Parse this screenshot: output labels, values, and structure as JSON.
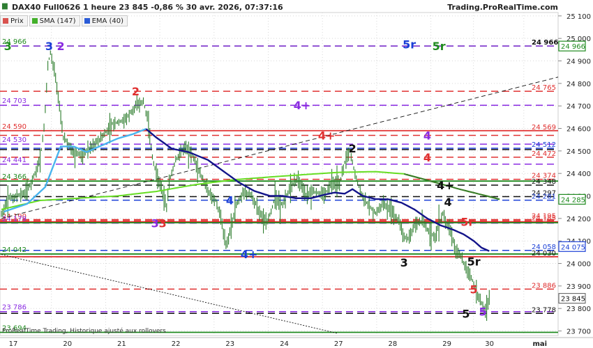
{
  "header": {
    "title": "DAX40 Full0626 1 heure 23 845 -0,86 % 30 avr. 2026, 07:37:16",
    "site": "Trading.ProRealTime.com"
  },
  "legend": [
    {
      "label": "Prix",
      "color": "#d9534f"
    },
    {
      "label": "SMA (147)",
      "color": "#43b02a"
    },
    {
      "label": "EMA (40)",
      "color": "#2a5bd7"
    }
  ],
  "footer": "ProRealTime Trading, Historique ajusté aux rollovers",
  "colors": {
    "green": "#1e8a1e",
    "purple": "#8a2be2",
    "red": "#e03030",
    "blue": "#1a3fd6",
    "black": "#111111",
    "sma": "#66dd22",
    "ema": "#49b4ee",
    "navy": "#13148a",
    "dark_green": "#3a7a2a"
  },
  "chart_data": {
    "type": "line",
    "x_ticks": [
      "17",
      "20",
      "21",
      "22",
      "23",
      "24",
      "27",
      "28",
      "29",
      "30",
      "mai"
    ],
    "y_ticks": [
      23700,
      23800,
      23900,
      24000,
      24100,
      24200,
      24300,
      24400,
      24500,
      24600,
      24700,
      24800,
      24900,
      25000,
      25100
    ],
    "y_tick_labels": [
      "23 700",
      "23 800",
      "23 900",
      "24 000",
      "24 100",
      "24 200",
      "24 300",
      "24 400",
      "24 500",
      "24 600",
      "24 700",
      "24 800",
      "24 900",
      "25 000",
      "25 100"
    ],
    "ylim": [
      23680,
      25115
    ],
    "last_price": {
      "value": 23845,
      "label": "23 845"
    },
    "price_boxes": [
      {
        "value": 24966,
        "label": "24 966",
        "color": "green"
      },
      {
        "value": 24285,
        "label": "24 285",
        "color": "green"
      },
      {
        "value": 24075,
        "label": "24 075",
        "color": "blue"
      }
    ],
    "levels": [
      {
        "value": 24966,
        "color": "green",
        "style": "dashed",
        "left": "24 966",
        "right": "24 966"
      },
      {
        "value": 24966,
        "color": "purple",
        "style": "dashed",
        "left": "",
        "right": ""
      },
      {
        "value": 24765,
        "color": "red",
        "style": "dashed",
        "left": "",
        "right": "24 765"
      },
      {
        "value": 24703,
        "color": "purple",
        "style": "dashed",
        "left": "24 703",
        "right": ""
      },
      {
        "value": 24590,
        "color": "red",
        "style": "solid",
        "left": "24 590",
        "right": "24 569"
      },
      {
        "value": 24569,
        "color": "red",
        "style": "dashed",
        "left": "",
        "right": ""
      },
      {
        "value": 24530,
        "color": "purple",
        "style": "dashed",
        "left": "24 530",
        "right": ""
      },
      {
        "value": 24512,
        "color": "blue",
        "style": "dashed",
        "left": "",
        "right": "24 512"
      },
      {
        "value": 24506,
        "color": "black",
        "style": "dashed",
        "left": "",
        "right": ""
      },
      {
        "value": 24472,
        "color": "red",
        "style": "dashed",
        "left": "",
        "right": "24 472"
      },
      {
        "value": 24441,
        "color": "purple",
        "style": "dashed",
        "left": "24 441",
        "right": ""
      },
      {
        "value": 24374,
        "color": "red",
        "style": "dashed",
        "left": "",
        "right": "24 374"
      },
      {
        "value": 24366,
        "color": "green",
        "style": "solid",
        "left": "24 366",
        "right": ""
      },
      {
        "value": 24348,
        "color": "black",
        "style": "dashed",
        "left": "",
        "right": "24 348"
      },
      {
        "value": 24297,
        "color": "black",
        "style": "dashed",
        "left": "",
        "right": "24 297"
      },
      {
        "value": 24281,
        "color": "blue",
        "style": "dashed",
        "left": "",
        "right": "24 281"
      },
      {
        "value": 24195,
        "color": "red",
        "style": "dashed",
        "left": "",
        "right": "24 195"
      },
      {
        "value": 24190,
        "color": "red",
        "style": "dashed",
        "left": "24 190",
        "right": ""
      },
      {
        "value": 24185,
        "color": "red",
        "style": "solid",
        "left": "",
        "right": "24 185"
      },
      {
        "value": 24179,
        "color": "purple",
        "style": "dashed",
        "left": "24 179",
        "right": ""
      },
      {
        "value": 24181,
        "color": "green",
        "style": "solid",
        "left": "",
        "right": ""
      },
      {
        "value": 24058,
        "color": "blue",
        "style": "dashed",
        "left": "",
        "right": "24 058"
      },
      {
        "value": 24042,
        "color": "green",
        "style": "solid",
        "left": "24 042",
        "right": ""
      },
      {
        "value": 24030,
        "color": "black",
        "style": "dashed",
        "left": "",
        "right": "24 030"
      },
      {
        "value": 24030,
        "color": "red",
        "style": "solid",
        "left": "",
        "right": ""
      },
      {
        "value": 23886,
        "color": "red",
        "style": "dashed",
        "left": "",
        "right": "23 886"
      },
      {
        "value": 23786,
        "color": "purple",
        "style": "dashed",
        "left": "23 786",
        "right": ""
      },
      {
        "value": 23778,
        "color": "black",
        "style": "dashed",
        "left": "",
        "right": "23 778"
      },
      {
        "value": 23694,
        "color": "green",
        "style": "solid",
        "left": "23 694",
        "right": ""
      }
    ],
    "markers": [
      {
        "text": "3",
        "color": "green",
        "bar": 5,
        "value": 24966,
        "size": 16
      },
      {
        "text": "3",
        "color": "blue",
        "bar": 37,
        "value": 24966,
        "size": 16
      },
      {
        "text": "2",
        "color": "purple",
        "bar": 46,
        "value": 24966,
        "size": 16
      },
      {
        "text": "5r",
        "color": "blue",
        "bar": 316,
        "value": 24975,
        "size": 16
      },
      {
        "text": "5r",
        "color": "green",
        "bar": 339,
        "value": 24966,
        "size": 16
      },
      {
        "text": "2",
        "color": "red",
        "bar": 104,
        "value": 24765,
        "size": 16
      },
      {
        "text": "4+",
        "color": "purple",
        "bar": 233,
        "value": 24703,
        "size": 16
      },
      {
        "text": "4+",
        "color": "red",
        "bar": 252,
        "value": 24569,
        "size": 16
      },
      {
        "text": "4",
        "color": "purple",
        "bar": 330,
        "value": 24569,
        "size": 16
      },
      {
        "text": "2",
        "color": "black",
        "bar": 272,
        "value": 24512,
        "size": 16
      },
      {
        "text": "4",
        "color": "red",
        "bar": 330,
        "value": 24472,
        "size": 16
      },
      {
        "text": "4+",
        "color": "black",
        "bar": 344,
        "value": 24348,
        "size": 16
      },
      {
        "text": "4",
        "color": "blue",
        "bar": 177,
        "value": 24281,
        "size": 16
      },
      {
        "text": "4",
        "color": "black",
        "bar": 346,
        "value": 24274,
        "size": 16
      },
      {
        "text": "3",
        "color": "purple",
        "bar": 119,
        "value": 24179,
        "size": 16
      },
      {
        "text": "3",
        "color": "red",
        "bar": 125,
        "value": 24179,
        "size": 16
      },
      {
        "text": "5r",
        "color": "red",
        "bar": 361,
        "value": 24185,
        "size": 16
      },
      {
        "text": "4+",
        "color": "blue",
        "bar": 192,
        "value": 24042,
        "size": 16
      },
      {
        "text": "3",
        "color": "black",
        "bar": 312,
        "value": 24004,
        "size": 16
      },
      {
        "text": "5r",
        "color": "black",
        "bar": 366,
        "value": 24010,
        "size": 16
      },
      {
        "text": "5",
        "color": "red",
        "bar": 366,
        "value": 23886,
        "size": 16
      },
      {
        "text": "5",
        "color": "black",
        "bar": 360,
        "value": 23778,
        "size": 16
      },
      {
        "text": "5",
        "color": "purple",
        "bar": 373,
        "value": 23786,
        "size": 16
      }
    ],
    "days": [
      {
        "label": "17",
        "start": 0
      },
      {
        "label": "20",
        "start": 42
      },
      {
        "label": "21",
        "start": 84
      },
      {
        "label": "22",
        "start": 126
      },
      {
        "label": "23",
        "start": 168
      },
      {
        "label": "24",
        "start": 210
      },
      {
        "label": "27",
        "start": 252
      },
      {
        "label": "28",
        "start": 294
      },
      {
        "label": "29",
        "start": 336
      },
      {
        "label": "30",
        "start": 369
      },
      {
        "label": "mai",
        "start": 408
      }
    ],
    "price_anchors": [
      [
        0,
        24222
      ],
      [
        6,
        24290
      ],
      [
        12,
        24300
      ],
      [
        18,
        24310
      ],
      [
        24,
        24370
      ],
      [
        30,
        24460
      ],
      [
        33,
        24600
      ],
      [
        36,
        24880
      ],
      [
        38,
        24940
      ],
      [
        41,
        24860
      ],
      [
        44,
        24740
      ],
      [
        48,
        24560
      ],
      [
        52,
        24530
      ],
      [
        56,
        24490
      ],
      [
        62,
        24480
      ],
      [
        70,
        24520
      ],
      [
        78,
        24560
      ],
      [
        86,
        24620
      ],
      [
        96,
        24640
      ],
      [
        104,
        24700
      ],
      [
        110,
        24720
      ],
      [
        114,
        24620
      ],
      [
        117,
        24470
      ],
      [
        120,
        24400
      ],
      [
        124,
        24330
      ],
      [
        128,
        24250
      ],
      [
        130,
        24360
      ],
      [
        135,
        24460
      ],
      [
        142,
        24520
      ],
      [
        148,
        24480
      ],
      [
        154,
        24400
      ],
      [
        160,
        24320
      ],
      [
        166,
        24280
      ],
      [
        170,
        24200
      ],
      [
        174,
        24080
      ],
      [
        178,
        24160
      ],
      [
        182,
        24260
      ],
      [
        188,
        24320
      ],
      [
        194,
        24300
      ],
      [
        200,
        24230
      ],
      [
        206,
        24180
      ],
      [
        212,
        24290
      ],
      [
        218,
        24260
      ],
      [
        224,
        24340
      ],
      [
        230,
        24380
      ],
      [
        236,
        24300
      ],
      [
        242,
        24320
      ],
      [
        250,
        24300
      ],
      [
        256,
        24360
      ],
      [
        262,
        24350
      ],
      [
        266,
        24450
      ],
      [
        270,
        24500
      ],
      [
        274,
        24400
      ],
      [
        278,
        24320
      ],
      [
        284,
        24260
      ],
      [
        290,
        24220
      ],
      [
        296,
        24270
      ],
      [
        302,
        24230
      ],
      [
        308,
        24190
      ],
      [
        312,
        24120
      ],
      [
        316,
        24110
      ],
      [
        320,
        24170
      ],
      [
        326,
        24190
      ],
      [
        330,
        24150
      ],
      [
        336,
        24120
      ],
      [
        342,
        24220
      ],
      [
        348,
        24140
      ],
      [
        352,
        24060
      ],
      [
        356,
        24030
      ],
      [
        360,
        23980
      ],
      [
        364,
        23940
      ],
      [
        368,
        23870
      ],
      [
        372,
        23820
      ],
      [
        375,
        23790
      ],
      [
        378,
        23845
      ]
    ],
    "sma_anchors": [
      [
        0,
        24240
      ],
      [
        30,
        24280
      ],
      [
        60,
        24290
      ],
      [
        90,
        24300
      ],
      [
        120,
        24320
      ],
      [
        150,
        24350
      ],
      [
        180,
        24372
      ],
      [
        210,
        24385
      ],
      [
        240,
        24397
      ],
      [
        262,
        24405
      ],
      [
        290,
        24408
      ],
      [
        312,
        24398
      ],
      [
        335,
        24362
      ],
      [
        355,
        24330
      ],
      [
        376,
        24300
      ],
      [
        386,
        24285
      ]
    ],
    "ema_anchors": [
      [
        2,
        24230
      ],
      [
        20,
        24265
      ],
      [
        34,
        24340
      ],
      [
        40,
        24430
      ],
      [
        46,
        24520
      ],
      [
        56,
        24520
      ],
      [
        66,
        24495
      ],
      [
        78,
        24525
      ],
      [
        90,
        24555
      ],
      [
        102,
        24575
      ],
      [
        112,
        24598
      ]
    ],
    "navy_anchors": [
      [
        112,
        24598
      ],
      [
        120,
        24560
      ],
      [
        132,
        24510
      ],
      [
        145,
        24495
      ],
      [
        160,
        24460
      ],
      [
        172,
        24410
      ],
      [
        184,
        24360
      ],
      [
        196,
        24322
      ],
      [
        208,
        24300
      ],
      [
        218,
        24300
      ],
      [
        228,
        24290
      ],
      [
        240,
        24290
      ],
      [
        250,
        24305
      ],
      [
        258,
        24315
      ],
      [
        266,
        24310
      ],
      [
        272,
        24330
      ],
      [
        280,
        24300
      ],
      [
        290,
        24286
      ],
      [
        300,
        24285
      ],
      [
        310,
        24270
      ],
      [
        320,
        24240
      ],
      [
        330,
        24200
      ],
      [
        340,
        24170
      ],
      [
        350,
        24150
      ],
      [
        358,
        24130
      ],
      [
        366,
        24100
      ],
      [
        372,
        24070
      ],
      [
        378,
        24055
      ]
    ],
    "trendlines": [
      {
        "from": [
          0,
          24200
        ],
        "to": [
          436,
          24835
        ],
        "color": "black"
      },
      {
        "from": [
          0,
          24040
        ],
        "to": [
          260,
          23690
        ],
        "color": "black"
      }
    ]
  }
}
